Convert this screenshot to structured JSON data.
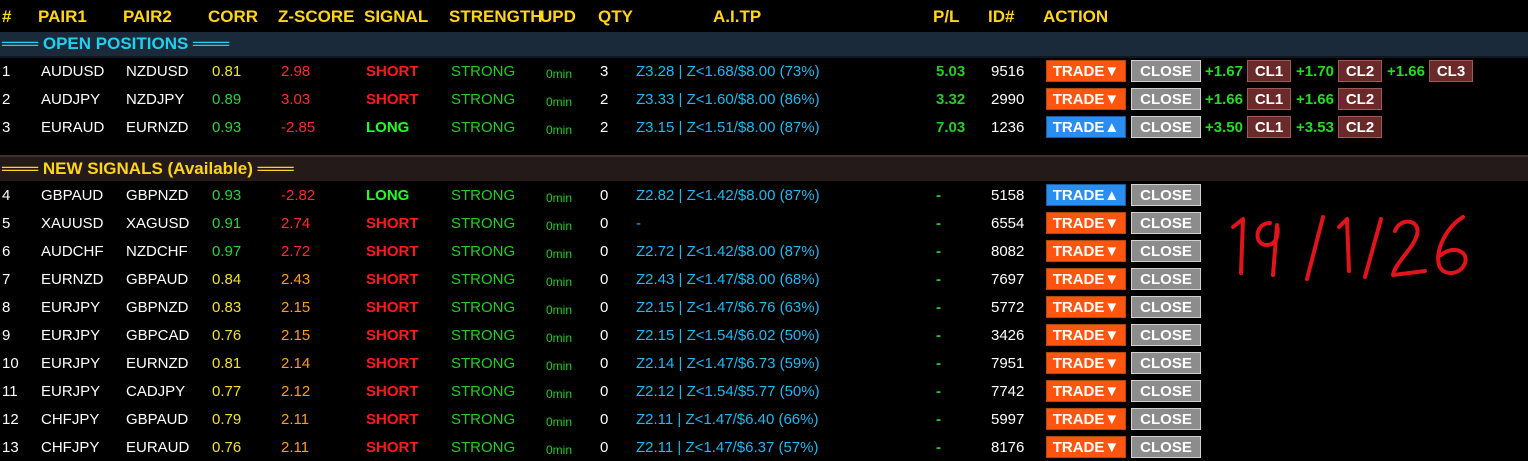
{
  "header": {
    "cols": [
      "#",
      "PAIR1",
      "PAIR2",
      "CORR",
      "Z-SCORE",
      "SIGNAL",
      "STRENGTH",
      "UPD",
      "QTY",
      "A.I.TP",
      "P/L",
      "ID#",
      "ACTION"
    ]
  },
  "sections": {
    "open": "═══ OPEN POSITIONS ═══",
    "new": "═══ NEW SIGNALS (Available) ═══"
  },
  "open_rows": [
    {
      "num": "1",
      "p1": "AUDUSD",
      "p2": "NZDUSD",
      "corr": "0.81",
      "z": "2.98",
      "signal": "SHORT",
      "strength": "STRONG",
      "upd": "0min",
      "qty": "3",
      "tp": "Z3.28 | Z<1.68/$8.00 (73%)",
      "pl": "5.03",
      "id": "9516",
      "trade": "TRADE▼",
      "close": "CLOSE",
      "cls": [
        {
          "val": "+1.67",
          "lbl": "CL1"
        },
        {
          "val": "+1.70",
          "lbl": "CL2"
        },
        {
          "val": "+1.66",
          "lbl": "CL3"
        }
      ]
    },
    {
      "num": "2",
      "p1": "AUDJPY",
      "p2": "NZDJPY",
      "corr": "0.89",
      "z": "3.03",
      "signal": "SHORT",
      "strength": "STRONG",
      "upd": "0min",
      "qty": "2",
      "tp": "Z3.33 | Z<1.60/$8.00 (86%)",
      "pl": "3.32",
      "id": "2990",
      "trade": "TRADE▼",
      "close": "CLOSE",
      "cls": [
        {
          "val": "+1.66",
          "lbl": "CL1"
        },
        {
          "val": "+1.66",
          "lbl": "CL2"
        }
      ]
    },
    {
      "num": "3",
      "p1": "EURAUD",
      "p2": "EURNZD",
      "corr": "0.93",
      "z": "-2.85",
      "signal": "LONG",
      "strength": "STRONG",
      "upd": "0min",
      "qty": "2",
      "tp": "Z3.15 | Z<1.51/$8.00 (87%)",
      "pl": "7.03",
      "id": "1236",
      "trade": "TRADE▲",
      "close": "CLOSE",
      "cls": [
        {
          "val": "+3.50",
          "lbl": "CL1"
        },
        {
          "val": "+3.53",
          "lbl": "CL2"
        }
      ]
    }
  ],
  "new_rows": [
    {
      "num": "4",
      "p1": "GBPAUD",
      "p2": "GBPNZD",
      "corr": "0.93",
      "z": "-2.82",
      "signal": "LONG",
      "strength": "STRONG",
      "upd": "0min",
      "qty": "0",
      "tp": "Z2.82 | Z<1.42/$8.00 (87%)",
      "pl": "-",
      "id": "5158",
      "trade": "TRADE▲",
      "close": "CLOSE"
    },
    {
      "num": "5",
      "p1": "XAUUSD",
      "p2": "XAGUSD",
      "corr": "0.91",
      "z": "2.74",
      "signal": "SHORT",
      "strength": "STRONG",
      "upd": "0min",
      "qty": "0",
      "tp": "-",
      "pl": "-",
      "id": "6554",
      "trade": "TRADE▼",
      "close": "CLOSE"
    },
    {
      "num": "6",
      "p1": "AUDCHF",
      "p2": "NZDCHF",
      "corr": "0.97",
      "z": "2.72",
      "signal": "SHORT",
      "strength": "STRONG",
      "upd": "0min",
      "qty": "0",
      "tp": "Z2.72 | Z<1.42/$8.00 (87%)",
      "pl": "-",
      "id": "8082",
      "trade": "TRADE▼",
      "close": "CLOSE"
    },
    {
      "num": "7",
      "p1": "EURNZD",
      "p2": "GBPAUD",
      "corr": "0.84",
      "z": "2.43",
      "signal": "SHORT",
      "strength": "STRONG",
      "upd": "0min",
      "qty": "0",
      "tp": "Z2.43 | Z<1.47/$8.00 (68%)",
      "pl": "-",
      "id": "7697",
      "trade": "TRADE▼",
      "close": "CLOSE"
    },
    {
      "num": "8",
      "p1": "EURJPY",
      "p2": "GBPNZD",
      "corr": "0.83",
      "z": "2.15",
      "signal": "SHORT",
      "strength": "STRONG",
      "upd": "0min",
      "qty": "0",
      "tp": "Z2.15 | Z<1.47/$6.76 (63%)",
      "pl": "-",
      "id": "5772",
      "trade": "TRADE▼",
      "close": "CLOSE"
    },
    {
      "num": "9",
      "p1": "EURJPY",
      "p2": "GBPCAD",
      "corr": "0.76",
      "z": "2.15",
      "signal": "SHORT",
      "strength": "STRONG",
      "upd": "0min",
      "qty": "0",
      "tp": "Z2.15 | Z<1.54/$6.02 (50%)",
      "pl": "-",
      "id": "3426",
      "trade": "TRADE▼",
      "close": "CLOSE"
    },
    {
      "num": "10",
      "p1": "EURJPY",
      "p2": "EURNZD",
      "corr": "0.81",
      "z": "2.14",
      "signal": "SHORT",
      "strength": "STRONG",
      "upd": "0min",
      "qty": "0",
      "tp": "Z2.14 | Z<1.47/$6.73 (59%)",
      "pl": "-",
      "id": "7951",
      "trade": "TRADE▼",
      "close": "CLOSE"
    },
    {
      "num": "11",
      "p1": "EURJPY",
      "p2": "CADJPY",
      "corr": "0.77",
      "z": "2.12",
      "signal": "SHORT",
      "strength": "STRONG",
      "upd": "0min",
      "qty": "0",
      "tp": "Z2.12 | Z<1.54/$5.77 (50%)",
      "pl": "-",
      "id": "7742",
      "trade": "TRADE▼",
      "close": "CLOSE"
    },
    {
      "num": "12",
      "p1": "CHFJPY",
      "p2": "GBPAUD",
      "corr": "0.79",
      "z": "2.11",
      "signal": "SHORT",
      "strength": "STRONG",
      "upd": "0min",
      "qty": "0",
      "tp": "Z2.11 | Z<1.47/$6.40 (66%)",
      "pl": "-",
      "id": "5997",
      "trade": "TRADE▼",
      "close": "CLOSE"
    },
    {
      "num": "13",
      "p1": "CHFJPY",
      "p2": "EURAUD",
      "corr": "0.76",
      "z": "2.11",
      "signal": "SHORT",
      "strength": "STRONG",
      "upd": "0min",
      "qty": "0",
      "tp": "Z2.11 | Z<1.47/$6.37 (57%)",
      "pl": "-",
      "id": "8176",
      "trade": "TRADE▼",
      "close": "CLOSE"
    }
  ],
  "annotation": "19/1/26",
  "colors": {
    "short": "#ff1a1a",
    "long": "#22ff22",
    "header": "#ffd51a",
    "tp": "#1fb8f0",
    "trade_short": "#ff5511",
    "trade_long": "#2a8ef0"
  }
}
